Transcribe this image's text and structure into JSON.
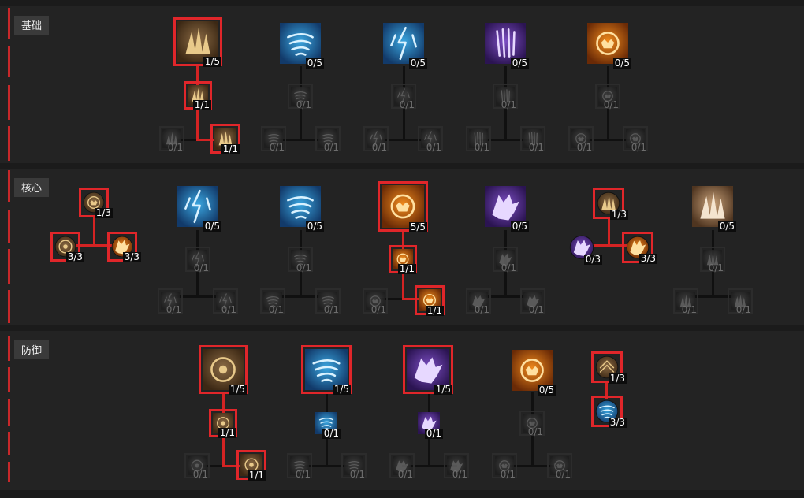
{
  "colors": {
    "selected_border": "#e0262a",
    "connector_active": "#d42323",
    "section_bg": "#232323",
    "page_bg": "#1b1b1b"
  },
  "sections": [
    {
      "id": "basic",
      "title": "基础",
      "nodes": [
        {
          "id": "b1",
          "icon": "wood-spikes-icon",
          "theme": "brown",
          "count": "1/5",
          "kind": "main",
          "active": true,
          "selected": true
        },
        {
          "id": "b1u",
          "icon": "wood-spikes-icon",
          "theme": "brown",
          "count": "1/1",
          "kind": "mod",
          "active": true,
          "selected": true
        },
        {
          "id": "b1a",
          "icon": "wood-spikes-icon",
          "theme": "gray",
          "count": "0/1",
          "kind": "mod",
          "active": false,
          "selected": false
        },
        {
          "id": "b1b",
          "icon": "wood-spikes-icon",
          "theme": "brown",
          "count": "1/1",
          "kind": "mod",
          "active": true,
          "selected": true
        },
        {
          "id": "b2",
          "icon": "wind-claw-icon",
          "theme": "blue",
          "count": "0/5",
          "kind": "main",
          "active": true,
          "selected": false
        },
        {
          "id": "b2u",
          "icon": "wind-claw-icon",
          "theme": "gray",
          "count": "0/1",
          "kind": "mod",
          "active": false,
          "selected": false
        },
        {
          "id": "b2a",
          "icon": "wind-claw-icon",
          "theme": "gray",
          "count": "0/1",
          "kind": "mod",
          "active": false,
          "selected": false
        },
        {
          "id": "b2b",
          "icon": "wind-claw-icon",
          "theme": "gray",
          "count": "0/1",
          "kind": "mod",
          "active": false,
          "selected": false
        },
        {
          "id": "b3",
          "icon": "storm-strike-icon",
          "theme": "blue",
          "count": "0/5",
          "kind": "main",
          "active": true,
          "selected": false
        },
        {
          "id": "b3u",
          "icon": "storm-strike-icon",
          "theme": "gray",
          "count": "0/1",
          "kind": "mod",
          "active": false,
          "selected": false
        },
        {
          "id": "b3a",
          "icon": "storm-strike-icon",
          "theme": "gray",
          "count": "0/1",
          "kind": "mod",
          "active": false,
          "selected": false
        },
        {
          "id": "b3b",
          "icon": "storm-strike-icon",
          "theme": "gray",
          "count": "0/1",
          "kind": "mod",
          "active": false,
          "selected": false
        },
        {
          "id": "b4",
          "icon": "claw-icon",
          "theme": "purple",
          "count": "0/5",
          "kind": "main",
          "active": true,
          "selected": false
        },
        {
          "id": "b4u",
          "icon": "claw-icon",
          "theme": "gray",
          "count": "0/1",
          "kind": "mod",
          "active": false,
          "selected": false
        },
        {
          "id": "b4a",
          "icon": "claw-icon",
          "theme": "gray",
          "count": "0/1",
          "kind": "mod",
          "active": false,
          "selected": false
        },
        {
          "id": "b4b",
          "icon": "claw-icon",
          "theme": "gray",
          "count": "0/1",
          "kind": "mod",
          "active": false,
          "selected": false
        },
        {
          "id": "b5",
          "icon": "maul-icon",
          "theme": "orange",
          "count": "0/5",
          "kind": "main",
          "active": true,
          "selected": false
        },
        {
          "id": "b5u",
          "icon": "maul-icon",
          "theme": "gray",
          "count": "0/1",
          "kind": "mod",
          "active": false,
          "selected": false
        },
        {
          "id": "b5a",
          "icon": "maul-icon",
          "theme": "gray",
          "count": "0/1",
          "kind": "mod",
          "active": false,
          "selected": false
        },
        {
          "id": "b5b",
          "icon": "maul-icon",
          "theme": "gray",
          "count": "0/1",
          "kind": "mod",
          "active": false,
          "selected": false
        }
      ]
    },
    {
      "id": "core",
      "title": "核心",
      "nodes": [
        {
          "id": "c0",
          "icon": "bear-passive-icon",
          "theme": "brown",
          "count": "1/3",
          "kind": "passive",
          "active": true,
          "selected": true
        },
        {
          "id": "c0a",
          "icon": "circle-passive-icon",
          "theme": "brown",
          "count": "3/3",
          "kind": "passive",
          "active": true,
          "selected": true
        },
        {
          "id": "c0b",
          "icon": "wolf-passive-icon",
          "theme": "orange",
          "count": "3/3",
          "kind": "passive",
          "active": true,
          "selected": true
        },
        {
          "id": "c1",
          "icon": "lightning-storm-icon",
          "theme": "blue",
          "count": "0/5",
          "kind": "main",
          "active": true,
          "selected": false
        },
        {
          "id": "c1u",
          "icon": "lightning-storm-icon",
          "theme": "gray",
          "count": "0/1",
          "kind": "mod",
          "active": false,
          "selected": false
        },
        {
          "id": "c1a",
          "icon": "lightning-storm-icon",
          "theme": "gray",
          "count": "0/1",
          "kind": "mod",
          "active": false,
          "selected": false
        },
        {
          "id": "c1b",
          "icon": "lightning-storm-icon",
          "theme": "gray",
          "count": "0/1",
          "kind": "mod",
          "active": false,
          "selected": false
        },
        {
          "id": "c2",
          "icon": "tornado-icon",
          "theme": "blue",
          "count": "0/5",
          "kind": "main",
          "active": true,
          "selected": false
        },
        {
          "id": "c2u",
          "icon": "tornado-icon",
          "theme": "gray",
          "count": "0/1",
          "kind": "mod",
          "active": false,
          "selected": false
        },
        {
          "id": "c2a",
          "icon": "tornado-icon",
          "theme": "gray",
          "count": "0/1",
          "kind": "mod",
          "active": false,
          "selected": false
        },
        {
          "id": "c2b",
          "icon": "tornado-icon",
          "theme": "gray",
          "count": "0/1",
          "kind": "mod",
          "active": false,
          "selected": false
        },
        {
          "id": "c3",
          "icon": "pulverize-icon",
          "theme": "orange",
          "count": "5/5",
          "kind": "main",
          "active": true,
          "selected": true
        },
        {
          "id": "c3u",
          "icon": "pulverize-icon",
          "theme": "orange",
          "count": "1/1",
          "kind": "mod",
          "active": true,
          "selected": true
        },
        {
          "id": "c3a",
          "icon": "pulverize-icon",
          "theme": "gray",
          "count": "0/1",
          "kind": "mod",
          "active": false,
          "selected": false
        },
        {
          "id": "c3b",
          "icon": "pulverize-icon",
          "theme": "orange",
          "count": "1/1",
          "kind": "mod",
          "active": true,
          "selected": true
        },
        {
          "id": "c4",
          "icon": "shred-icon",
          "theme": "purple",
          "count": "0/5",
          "kind": "main",
          "active": true,
          "selected": false
        },
        {
          "id": "c4u",
          "icon": "shred-icon",
          "theme": "gray",
          "count": "0/1",
          "kind": "mod",
          "active": false,
          "selected": false
        },
        {
          "id": "c4a",
          "icon": "shred-icon",
          "theme": "gray",
          "count": "0/1",
          "kind": "mod",
          "active": false,
          "selected": false
        },
        {
          "id": "c4b",
          "icon": "shred-icon",
          "theme": "gray",
          "count": "0/1",
          "kind": "mod",
          "active": false,
          "selected": false
        },
        {
          "id": "c5",
          "icon": "arrow-passive-icon",
          "theme": "brown",
          "count": "1/3",
          "kind": "passive",
          "active": true,
          "selected": true
        },
        {
          "id": "c5a",
          "icon": "wolf-passive-icon",
          "theme": "purple",
          "count": "0/3",
          "kind": "passive",
          "active": true,
          "selected": false
        },
        {
          "id": "c5b",
          "icon": "beast-passive-icon",
          "theme": "orange",
          "count": "3/3",
          "kind": "passive",
          "active": true,
          "selected": true
        },
        {
          "id": "c6",
          "icon": "landslide-icon",
          "theme": "tan",
          "count": "0/5",
          "kind": "main",
          "active": true,
          "selected": false
        },
        {
          "id": "c6u",
          "icon": "landslide-icon",
          "theme": "gray",
          "count": "0/1",
          "kind": "mod",
          "active": false,
          "selected": false
        },
        {
          "id": "c6a",
          "icon": "landslide-icon",
          "theme": "gray",
          "count": "0/1",
          "kind": "mod",
          "active": false,
          "selected": false
        },
        {
          "id": "c6b",
          "icon": "landslide-icon",
          "theme": "gray",
          "count": "0/1",
          "kind": "mod",
          "active": false,
          "selected": false
        }
      ]
    },
    {
      "id": "defense",
      "title": "防御",
      "nodes": [
        {
          "id": "d1",
          "icon": "earthen-bulwark-icon",
          "theme": "brown",
          "count": "1/5",
          "kind": "main",
          "active": true,
          "selected": true
        },
        {
          "id": "d1u",
          "icon": "earthen-bulwark-icon",
          "theme": "brown",
          "count": "1/1",
          "kind": "mod",
          "active": true,
          "selected": true
        },
        {
          "id": "d1a",
          "icon": "earthen-bulwark-icon",
          "theme": "gray",
          "count": "0/1",
          "kind": "mod",
          "active": false,
          "selected": false
        },
        {
          "id": "d1b",
          "icon": "earthen-bulwark-icon",
          "theme": "brown",
          "count": "1/1",
          "kind": "mod",
          "active": true,
          "selected": true
        },
        {
          "id": "d2",
          "icon": "cyclone-armor-icon",
          "theme": "blue",
          "count": "1/5",
          "kind": "main",
          "active": true,
          "selected": true
        },
        {
          "id": "d2u",
          "icon": "cyclone-armor-icon",
          "theme": "blue",
          "count": "0/1",
          "kind": "mod",
          "active": true,
          "selected": false
        },
        {
          "id": "d2a",
          "icon": "cyclone-armor-icon",
          "theme": "gray",
          "count": "0/1",
          "kind": "mod",
          "active": false,
          "selected": false
        },
        {
          "id": "d2b",
          "icon": "cyclone-armor-icon",
          "theme": "gray",
          "count": "0/1",
          "kind": "mod",
          "active": false,
          "selected": false
        },
        {
          "id": "d3",
          "icon": "blood-howl-icon",
          "theme": "purple",
          "count": "1/5",
          "kind": "main",
          "active": true,
          "selected": true
        },
        {
          "id": "d3u",
          "icon": "blood-howl-icon",
          "theme": "purple",
          "count": "0/1",
          "kind": "mod",
          "active": true,
          "selected": false
        },
        {
          "id": "d3a",
          "icon": "blood-howl-icon",
          "theme": "gray",
          "count": "0/1",
          "kind": "mod",
          "active": false,
          "selected": false
        },
        {
          "id": "d3b",
          "icon": "blood-howl-icon",
          "theme": "gray",
          "count": "0/1",
          "kind": "mod",
          "active": false,
          "selected": false
        },
        {
          "id": "d4",
          "icon": "debilitating-roar-icon",
          "theme": "orange",
          "count": "0/5",
          "kind": "main",
          "active": true,
          "selected": false
        },
        {
          "id": "d4u",
          "icon": "debilitating-roar-icon",
          "theme": "gray",
          "count": "0/1",
          "kind": "mod",
          "active": false,
          "selected": false
        },
        {
          "id": "d4a",
          "icon": "debilitating-roar-icon",
          "theme": "gray",
          "count": "0/1",
          "kind": "mod",
          "active": false,
          "selected": false
        },
        {
          "id": "d4b",
          "icon": "debilitating-roar-icon",
          "theme": "gray",
          "count": "0/1",
          "kind": "mod",
          "active": false,
          "selected": false
        },
        {
          "id": "d5",
          "icon": "chevron-passive-icon",
          "theme": "brown",
          "count": "1/3",
          "kind": "passive",
          "active": true,
          "selected": true
        },
        {
          "id": "d5a",
          "icon": "spiral-passive-icon",
          "theme": "blue",
          "count": "3/3",
          "kind": "passive",
          "active": true,
          "selected": true
        }
      ]
    }
  ]
}
